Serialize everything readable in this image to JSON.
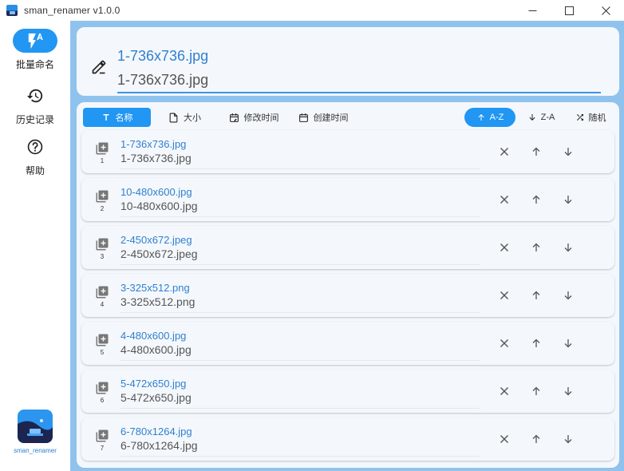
{
  "window": {
    "title": "sman_renamer v1.0.0",
    "icon": "app-logo-icon",
    "controls": [
      "minimize-icon",
      "maximize-icon",
      "close-icon"
    ]
  },
  "sidebar": {
    "items": [
      {
        "label": "批量命名",
        "icon": "flash-auto-icon",
        "active": true
      },
      {
        "label": "历史记录",
        "icon": "history-icon",
        "active": false
      },
      {
        "label": "帮助",
        "icon": "help-circle-icon",
        "active": false
      }
    ],
    "logo_label": "sman_renamer"
  },
  "editor": {
    "original_name": "1-736x736.jpg",
    "new_name_value": "1-736x736.jpg"
  },
  "sort": {
    "fields": [
      {
        "label": "名称",
        "icon": "text-icon",
        "active": true
      },
      {
        "label": "大小",
        "icon": "file-icon",
        "active": false
      },
      {
        "label": "修改时间",
        "icon": "calendar-edit-icon",
        "active": false
      },
      {
        "label": "创建时间",
        "icon": "calendar-icon",
        "active": false
      }
    ],
    "orders": [
      {
        "label": "A-Z",
        "icon": "arrow-up-icon",
        "active": true
      },
      {
        "label": "Z-A",
        "icon": "arrow-down-icon",
        "active": false
      },
      {
        "label": "随机",
        "icon": "shuffle-icon",
        "active": false
      }
    ]
  },
  "files": [
    {
      "index": "1",
      "new_name": "1-736x736.jpg",
      "old_name": "1-736x736.jpg"
    },
    {
      "index": "2",
      "new_name": "10-480x600.jpg",
      "old_name": "10-480x600.jpg"
    },
    {
      "index": "3",
      "new_name": "2-450x672.jpeg",
      "old_name": "2-450x672.jpeg"
    },
    {
      "index": "4",
      "new_name": "3-325x512.png",
      "old_name": "3-325x512.png"
    },
    {
      "index": "5",
      "new_name": "4-480x600.jpg",
      "old_name": "4-480x600.jpg"
    },
    {
      "index": "6",
      "new_name": "5-472x650.jpg",
      "old_name": "5-472x650.jpg"
    },
    {
      "index": "7",
      "new_name": "6-780x1264.jpg",
      "old_name": "6-780x1264.jpg"
    }
  ],
  "colors": {
    "accent": "#2196f3",
    "main_background": "#8fc3ee",
    "card_background": "#f4f8fc",
    "new_name_text": "#2f7fd0"
  }
}
